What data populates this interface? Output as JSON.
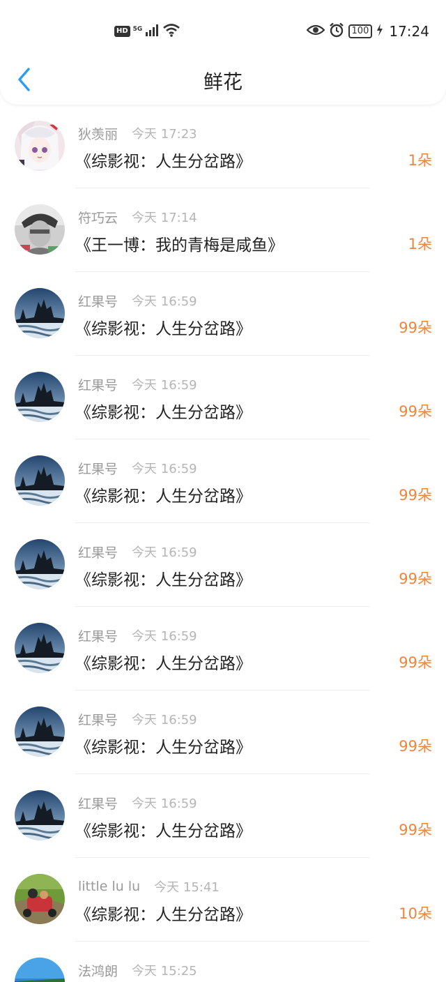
{
  "status_bar": {
    "hd": "HD",
    "network": "5G",
    "battery": "100",
    "time": "17:24"
  },
  "navbar": {
    "title": "鲜花",
    "back_icon": "chevron-left-icon"
  },
  "colors": {
    "accent_blue": "#2a9df4",
    "count_orange": "#f0843c",
    "title_text": "#222222",
    "meta_text": "#9a9a9a"
  },
  "list": [
    {
      "name": "狄羡丽",
      "time": "今天 17:23",
      "book": "《综影视：人生分岔路》",
      "count": "1朵",
      "avatar": "anime-avatar"
    },
    {
      "name": "符巧云",
      "time": "今天 17:14",
      "book": "《王一博：我的青梅是咸鱼》",
      "count": "1朵",
      "avatar": "photo-avatar"
    },
    {
      "name": "红果号",
      "time": "今天 16:59",
      "book": "《综影视：人生分岔路》",
      "count": "99朵",
      "avatar": "landscape-avatar"
    },
    {
      "name": "红果号",
      "time": "今天 16:59",
      "book": "《综影视：人生分岔路》",
      "count": "99朵",
      "avatar": "landscape-avatar"
    },
    {
      "name": "红果号",
      "time": "今天 16:59",
      "book": "《综影视：人生分岔路》",
      "count": "99朵",
      "avatar": "landscape-avatar"
    },
    {
      "name": "红果号",
      "time": "今天 16:59",
      "book": "《综影视：人生分岔路》",
      "count": "99朵",
      "avatar": "landscape-avatar"
    },
    {
      "name": "红果号",
      "time": "今天 16:59",
      "book": "《综影视：人生分岔路》",
      "count": "99朵",
      "avatar": "landscape-avatar"
    },
    {
      "name": "红果号",
      "time": "今天 16:59",
      "book": "《综影视：人生分岔路》",
      "count": "99朵",
      "avatar": "landscape-avatar"
    },
    {
      "name": "红果号",
      "time": "今天 16:59",
      "book": "《综影视：人生分岔路》",
      "count": "99朵",
      "avatar": "landscape-avatar"
    },
    {
      "name": "little lu lu",
      "time": "今天 15:41",
      "book": "《综影视：人生分岔路》",
      "count": "10朵",
      "avatar": "kart-avatar"
    },
    {
      "name": "法鸿朗",
      "time": "今天 15:25",
      "book": "",
      "count": "",
      "avatar": "beach-avatar"
    }
  ]
}
